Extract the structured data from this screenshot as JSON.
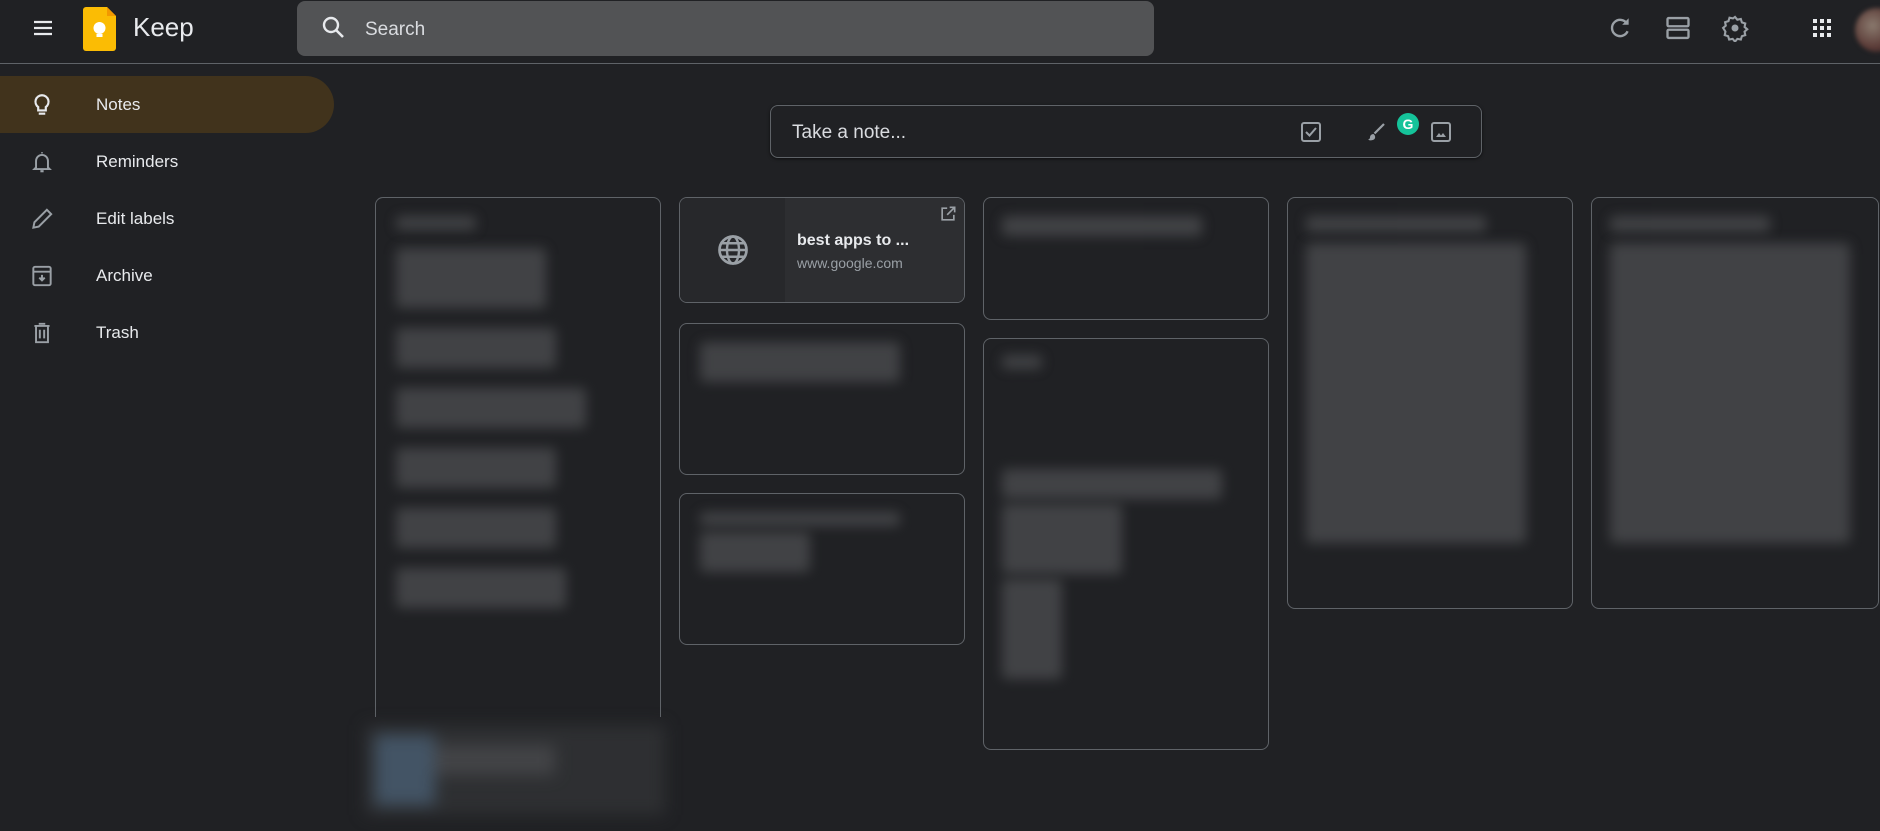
{
  "header": {
    "app_title": "Keep",
    "search_placeholder": "Search",
    "icons": [
      "menu-icon",
      "keep-logo",
      "search-icon",
      "refresh-icon",
      "list-view-icon",
      "settings-icon",
      "apps-grid-icon",
      "account-avatar"
    ]
  },
  "sidebar": {
    "items": [
      {
        "label": "Notes",
        "icon": "lightbulb-icon",
        "active": true
      },
      {
        "label": "Reminders",
        "icon": "bell-icon",
        "active": false
      },
      {
        "label": "Edit labels",
        "icon": "pencil-icon",
        "active": false
      },
      {
        "label": "Archive",
        "icon": "archive-icon",
        "active": false
      },
      {
        "label": "Trash",
        "icon": "trash-icon",
        "active": false
      }
    ]
  },
  "take_note": {
    "placeholder": "Take a note...",
    "actions": [
      "new-list",
      "new-drawing",
      "new-image"
    ],
    "grammarly_badge": "G"
  },
  "colors": {
    "background": "#202124",
    "active_nav": "#41331c",
    "keep_yellow": "#fbbc04",
    "grammarly": "#15c39a"
  },
  "notes": {
    "link_card": {
      "title": "best apps to ...",
      "url": "www.google.com"
    },
    "blurred_note_count": 8
  }
}
